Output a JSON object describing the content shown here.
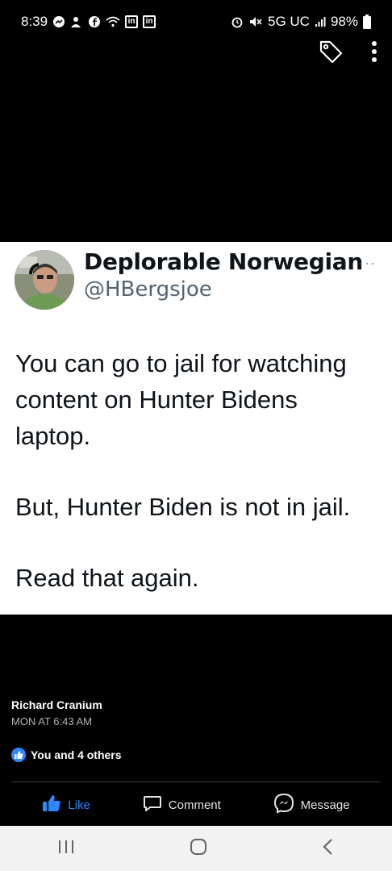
{
  "status_bar": {
    "time": "8:39",
    "network": "5G UC",
    "battery": "98%",
    "icons_left": [
      "messenger-icon",
      "account-icon",
      "facebook-icon",
      "wifi-icon",
      "linkedin-icon",
      "linkedin-icon"
    ],
    "icons_right": [
      "alarm-icon",
      "mute-icon",
      "signal-icon",
      "battery-icon"
    ]
  },
  "top_actions": [
    "tag-icon",
    "more-vertical-icon"
  ],
  "tweet": {
    "display_name": "Deplorable Norwegian",
    "handle": "@HBergsjoe",
    "more": "···",
    "lines": [
      "You can go to jail for watching content on Hunter Bidens laptop.",
      "But, Hunter Biden is not in jail.",
      "Read that again."
    ]
  },
  "post": {
    "poster_name": "Richard Cranium",
    "timestamp": "MON AT 6:43 AM",
    "reactions_text": "You and 4 others"
  },
  "actions": {
    "like": "Like",
    "comment": "Comment",
    "message": "Message"
  },
  "colors": {
    "like_blue": "#2d88ff",
    "handle_gray": "#536471",
    "nav_bg": "#f2f2f2"
  }
}
